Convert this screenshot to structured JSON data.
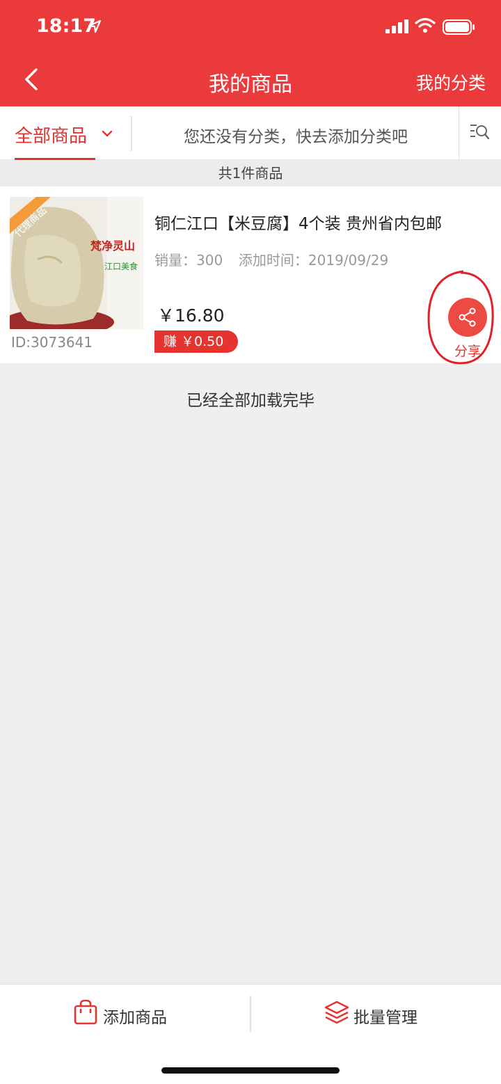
{
  "status_bar": {
    "time": "18:17"
  },
  "nav": {
    "title": "我的商品",
    "right_label": "我的分类"
  },
  "filter": {
    "tab_label": "全部商品",
    "category_hint": "您还没有分类，快去添加分类吧"
  },
  "summary": {
    "count_text": "共1件商品"
  },
  "product": {
    "title": "铜仁江口【米豆腐】4个装 贵州省内包邮",
    "sales_label": "销量：",
    "sales": "300",
    "added_label": "添加时间：",
    "added_date": "2019/09/29",
    "price": "￥16.80",
    "earn": "赚 ￥0.50",
    "id": "ID:3073641",
    "badge": "代理商品",
    "brand_line1": "梵净灵山",
    "brand_line2": "江口美食",
    "share_label": "分享"
  },
  "list": {
    "end_text": "已经全部加载完毕"
  },
  "bottom_bar": {
    "add_label": "添加商品",
    "batch_label": "批量管理"
  },
  "colors": {
    "brand_red": "#ea3a3c",
    "accent_red": "#e5342f",
    "background": "#efefef"
  },
  "icons": [
    "location-arrow-icon",
    "signal-icon",
    "wifi-icon",
    "battery-icon",
    "back-arrow-icon",
    "chevron-down-icon",
    "search-list-icon",
    "share-icon",
    "shopping-bag-icon",
    "layers-icon"
  ]
}
